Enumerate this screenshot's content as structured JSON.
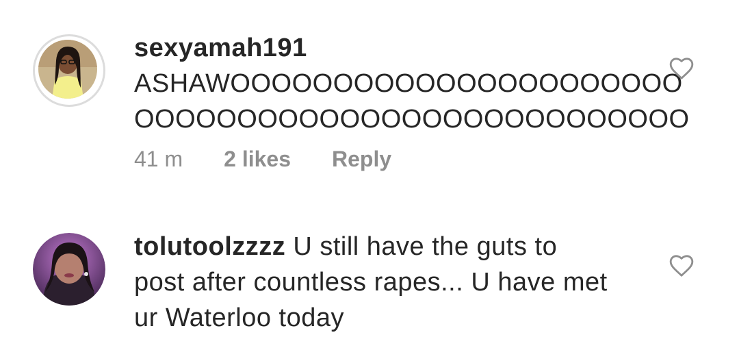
{
  "comments": [
    {
      "username": "sexyamah191",
      "text_lines": [
        "ASHAWOOOOOOOOOOOOOOOOOOOOOO",
        "OOOOOOOOOOOOOOOOOOOOOOOOOOO"
      ],
      "time": "41 m",
      "likes": "2 likes",
      "reply": "Reply",
      "avatar": "profile-photo-woman-glasses"
    },
    {
      "username": "tolutoolzzzz",
      "text_first": "U still have the guts to",
      "text_lines": [
        "post after countless rapes... U have met",
        "ur Waterloo today"
      ],
      "avatar": "profile-photo-woman-purple-light"
    }
  ],
  "icons": {
    "like": "heart-outline-icon"
  },
  "colors": {
    "text": "#262626",
    "meta": "#8e8e8e",
    "heart": "#8e8e8e"
  }
}
